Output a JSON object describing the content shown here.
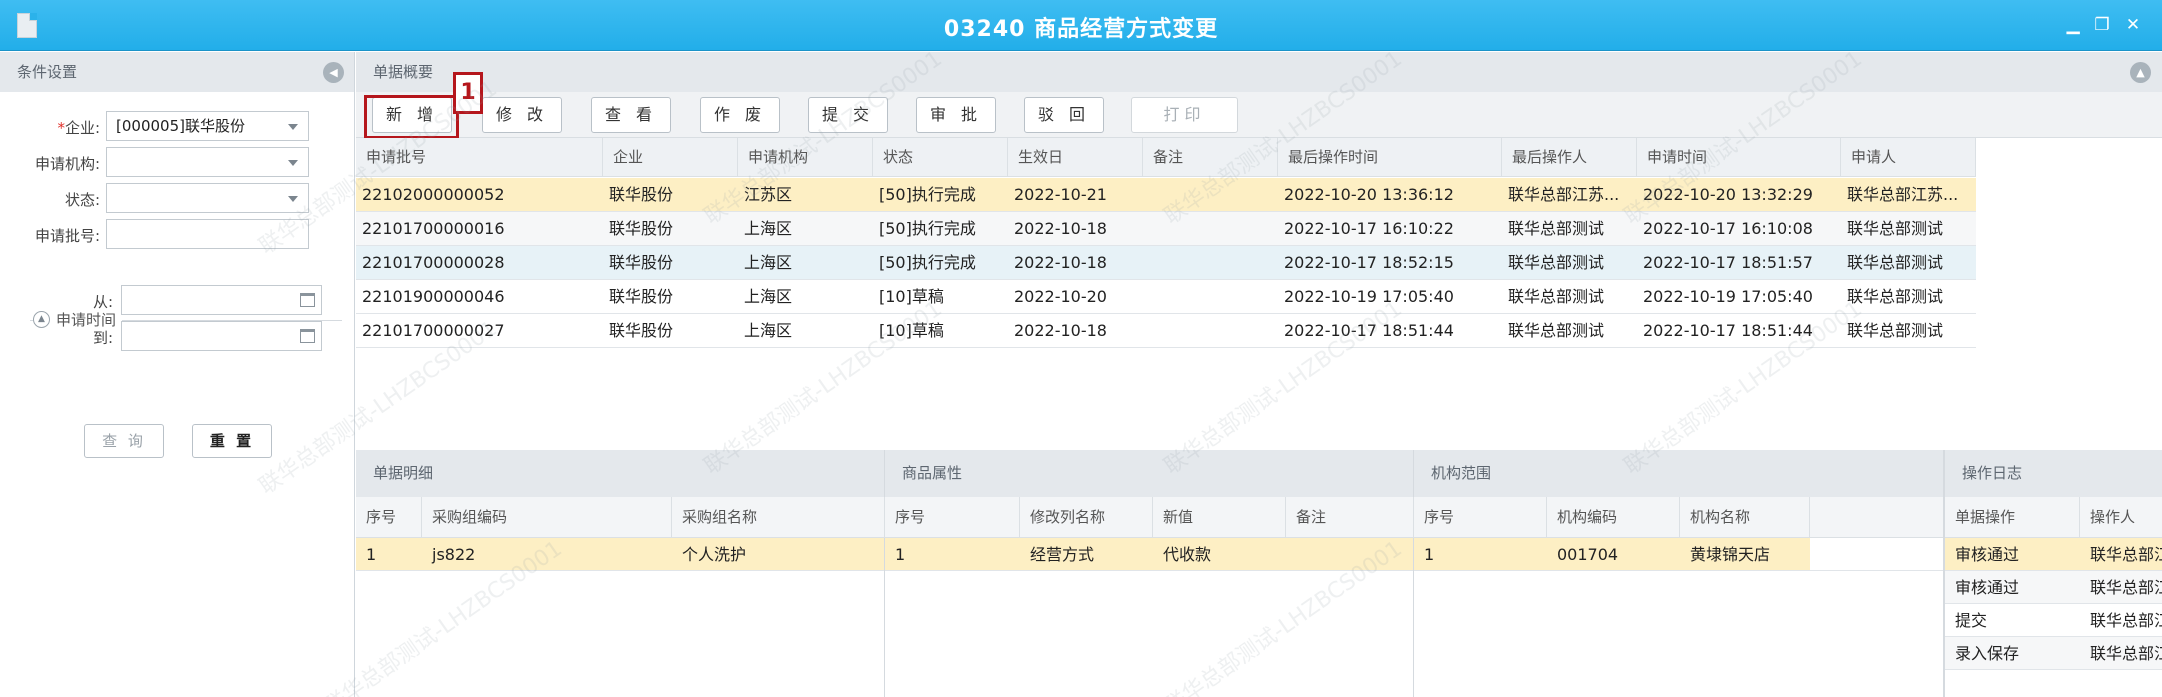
{
  "window": {
    "title": "03240 商品经营方式变更"
  },
  "left_panel": {
    "header": "条件设置",
    "fields": {
      "company_label": "企业:",
      "company_value": "[000005]联华股份",
      "org_label": "申请机构:",
      "status_label": "状态:",
      "batch_label": "申请批号:",
      "time_section": "申请时间",
      "from_label": "从:",
      "to_label": "到:"
    },
    "buttons": {
      "query": "查 询",
      "reset": "重 置"
    }
  },
  "main": {
    "header": "单据概要",
    "toolbar": [
      "新 增",
      "修 改",
      "查 看",
      "作 废",
      "提 交",
      "审 批",
      "驳 回",
      "打印"
    ],
    "callout": "1",
    "grid": {
      "columns": [
        "申请批号",
        "企业",
        "申请机构",
        "状态",
        "生效日",
        "备注",
        "最后操作时间",
        "最后操作人",
        "申请时间",
        "申请人"
      ],
      "rows": [
        [
          "22102000000052",
          "联华股份",
          "江苏区",
          "[50]执行完成",
          "2022-10-21",
          "",
          "2022-10-20 13:36:12",
          "联华总部江苏...",
          "2022-10-20 13:32:29",
          "联华总部江苏..."
        ],
        [
          "22101700000016",
          "联华股份",
          "上海区",
          "[50]执行完成",
          "2022-10-18",
          "",
          "2022-10-17 16:10:22",
          "联华总部测试",
          "2022-10-17 16:10:08",
          "联华总部测试"
        ],
        [
          "22101700000028",
          "联华股份",
          "上海区",
          "[50]执行完成",
          "2022-10-18",
          "",
          "2022-10-17 18:52:15",
          "联华总部测试",
          "2022-10-17 18:51:57",
          "联华总部测试"
        ],
        [
          "22101900000046",
          "联华股份",
          "上海区",
          "[10]草稿",
          "2022-10-20",
          "",
          "2022-10-19 17:05:40",
          "联华总部测试",
          "2022-10-19 17:05:40",
          "联华总部测试"
        ],
        [
          "22101700000027",
          "联华股份",
          "上海区",
          "[10]草稿",
          "2022-10-18",
          "",
          "2022-10-17 18:51:44",
          "联华总部测试",
          "2022-10-17 18:51:44",
          "联华总部测试"
        ]
      ]
    }
  },
  "detail": {
    "header": "单据明细",
    "columns": [
      "序号",
      "采购组编码",
      "采购组名称"
    ],
    "rows": [
      [
        "1",
        "js822",
        "个人洗护"
      ]
    ]
  },
  "attributes": {
    "header": "商品属性",
    "columns": [
      "序号",
      "修改列名称",
      "新值",
      "备注"
    ],
    "rows": [
      [
        "1",
        "经营方式",
        "代收款",
        ""
      ]
    ]
  },
  "org_scope": {
    "header": "机构范围",
    "columns": [
      "序号",
      "机构编码",
      "机构名称"
    ],
    "rows": [
      [
        "1",
        "001704",
        "黄埭锦天店"
      ]
    ]
  },
  "op_log": {
    "header": "操作日志",
    "columns": [
      "单据操作",
      "操作人"
    ],
    "rows": [
      [
        "审核通过",
        "联华总部江"
      ],
      [
        "审核通过",
        "联华总部江"
      ],
      [
        "提交",
        "联华总部江"
      ],
      [
        "录入保存",
        "联华总部江"
      ]
    ]
  },
  "colors": {
    "title_bar": "#2bb2ea",
    "selected_row": "#fdefc4",
    "callout": "#b5161c"
  },
  "watermark": "联华总部测试-LHZBCS0001"
}
